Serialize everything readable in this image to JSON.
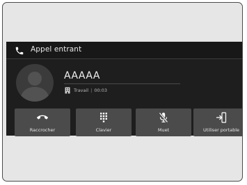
{
  "header": {
    "title": "Appel entrant",
    "icon": "phone-icon"
  },
  "caller": {
    "name": "AAAAA",
    "type": "Travail",
    "duration": "00:03",
    "type_icon": "work-building-icon"
  },
  "actions": [
    {
      "label": "Raccrocher",
      "icon": "hang-up-icon"
    },
    {
      "label": "Clavier",
      "icon": "keypad-icon"
    },
    {
      "label": "Muet",
      "icon": "mic-muted-icon"
    },
    {
      "label": "Utiliser portable",
      "icon": "transfer-to-phone-icon"
    }
  ],
  "colors": {
    "screen_bg": "#1e1e1e",
    "button_bg": "#4b4b4b",
    "text": "#f2f2f2",
    "frame_bg": "#e6e6e6"
  }
}
